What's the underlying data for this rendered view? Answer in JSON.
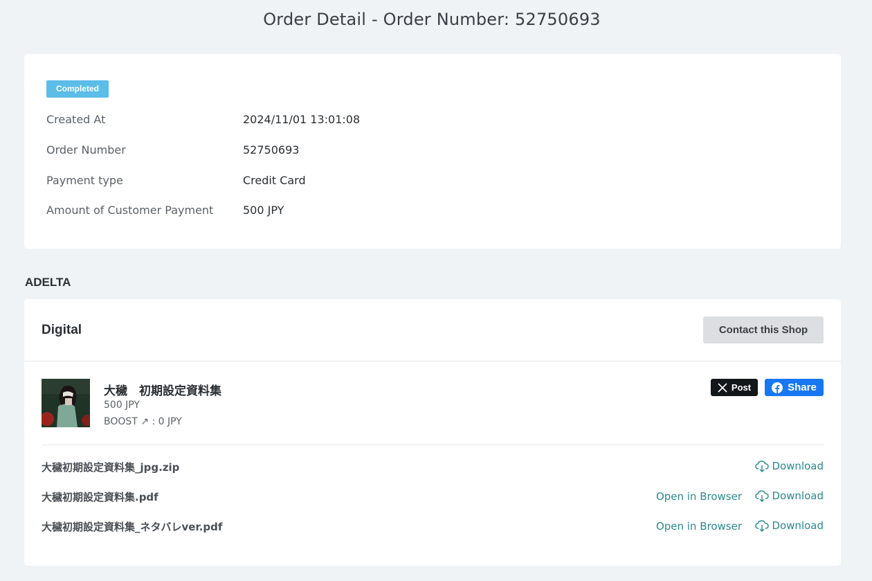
{
  "page": {
    "title": "Order Detail - Order Number: 52750693"
  },
  "order": {
    "status": "Completed",
    "rows": [
      {
        "label": "Created At",
        "value": "2024/11/01 13:01:08"
      },
      {
        "label": "Order Number",
        "value": "52750693"
      },
      {
        "label": "Payment type",
        "value": "Credit Card"
      },
      {
        "label": "Amount of Customer Payment",
        "value": "500 JPY"
      }
    ],
    "colors": {
      "status_badge": "#5bbde8"
    }
  },
  "shop": {
    "name": "ADELTA",
    "section_title": "Digital",
    "contact_label": "Contact this Shop"
  },
  "product": {
    "title": "大穢　初期設定資料集",
    "price": "500 JPY",
    "boost": "BOOST ↗ : 0 JPY",
    "post_label": "Post",
    "share_label": "Share"
  },
  "files": [
    {
      "name": "大穢初期設定資料集_jpg.zip",
      "open_label": "",
      "download_label": "Download"
    },
    {
      "name": "大穢初期設定資料集.pdf",
      "open_label": "Open in Browser",
      "download_label": "Download"
    },
    {
      "name": "大穢初期設定資料集_ネタバレver.pdf",
      "open_label": "Open in Browser",
      "download_label": "Download"
    }
  ],
  "icons": {
    "post": "x-logo-icon",
    "share": "facebook-icon",
    "download": "cloud-download-icon",
    "thumbnail": "product-thumbnail"
  },
  "colors": {
    "link": "#2a8a8f",
    "facebook": "#1877f2",
    "x_button": "#14171a",
    "background": "#f0f3f6"
  }
}
